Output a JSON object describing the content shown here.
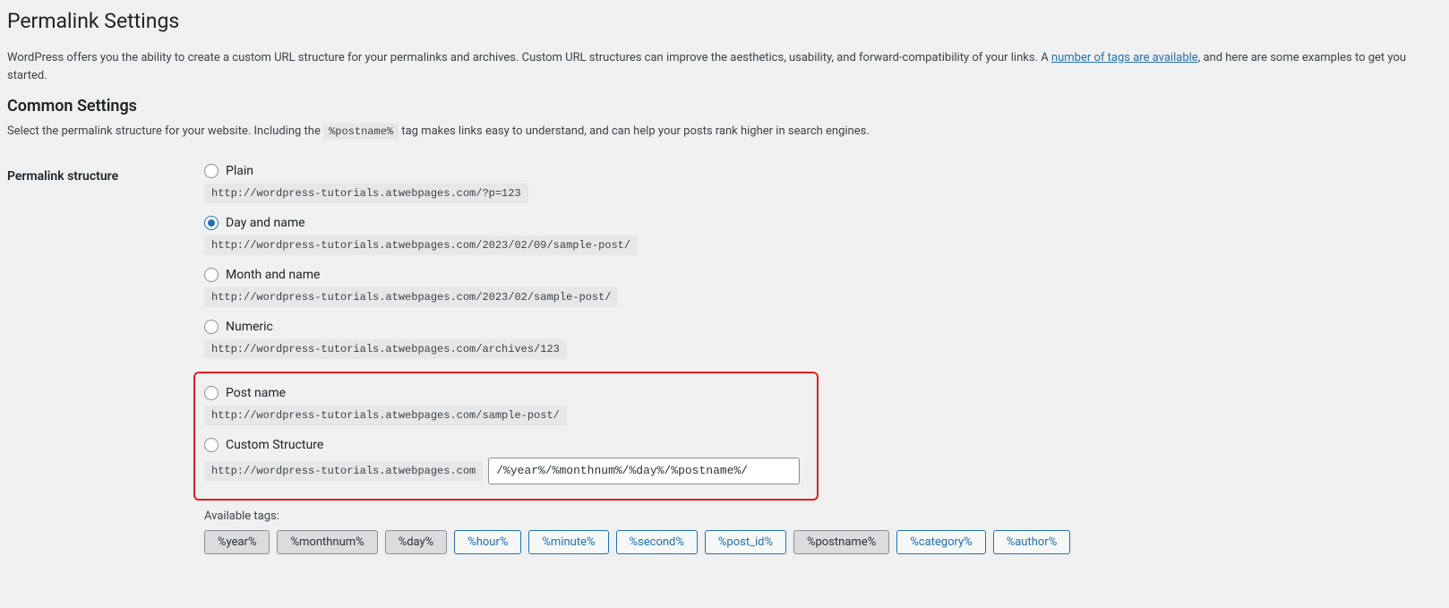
{
  "page": {
    "title": "Permalink Settings",
    "intro_before_link": "WordPress offers you the ability to create a custom URL structure for your permalinks and archives. Custom URL structures can improve the aesthetics, usability, and forward-compatibility of your links. A ",
    "intro_link_text": "number of tags are available",
    "intro_after_link": ", and here are some examples to get you started."
  },
  "common": {
    "heading": "Common Settings",
    "desc_before_code": "Select the permalink structure for your website. Including the ",
    "desc_code": "%postname%",
    "desc_after_code": " tag makes links easy to understand, and can help your posts rank higher in search engines."
  },
  "form": {
    "row_label": "Permalink structure",
    "options": {
      "plain": {
        "label": "Plain",
        "example": "http://wordpress-tutorials.atwebpages.com/?p=123"
      },
      "day_name": {
        "label": "Day and name",
        "example": "http://wordpress-tutorials.atwebpages.com/2023/02/09/sample-post/"
      },
      "month_name": {
        "label": "Month and name",
        "example": "http://wordpress-tutorials.atwebpages.com/2023/02/sample-post/"
      },
      "numeric": {
        "label": "Numeric",
        "example": "http://wordpress-tutorials.atwebpages.com/archives/123"
      },
      "post_name": {
        "label": "Post name",
        "example": "http://wordpress-tutorials.atwebpages.com/sample-post/"
      },
      "custom": {
        "label": "Custom Structure",
        "base": "http://wordpress-tutorials.atwebpages.com",
        "value": "/%year%/%monthnum%/%day%/%postname%/"
      }
    },
    "selected": "day_name"
  },
  "tags": {
    "label": "Available tags:",
    "items": [
      "%year%",
      "%monthnum%",
      "%day%",
      "%hour%",
      "%minute%",
      "%second%",
      "%post_id%",
      "%postname%",
      "%category%",
      "%author%"
    ],
    "pressed": [
      "%year%",
      "%monthnum%",
      "%day%",
      "%postname%"
    ]
  }
}
